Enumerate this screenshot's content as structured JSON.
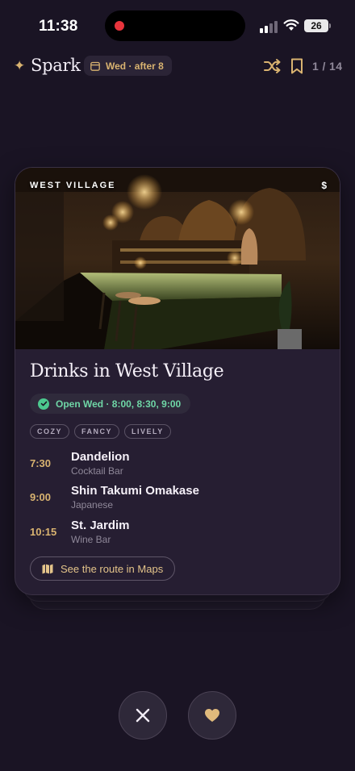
{
  "status_bar": {
    "time": "11:38",
    "battery": "26"
  },
  "header": {
    "app_name": "Spark",
    "date_filter": "Wed · after 8",
    "counter": "1 / 14"
  },
  "card": {
    "neighborhood": "WEST VILLAGE",
    "price": "$",
    "title": "Drinks in West Village",
    "availability": "Open Wed · 8:00, 8:30, 9:00",
    "tags": [
      "COZY",
      "FANCY",
      "LIVELY"
    ],
    "stops": [
      {
        "time": "7:30",
        "name": "Dandelion",
        "type": "Cocktail Bar"
      },
      {
        "time": "9:00",
        "name": "Shin Takumi Omakase",
        "type": "Japanese"
      },
      {
        "time": "10:15",
        "name": "St. Jardim",
        "type": "Wine Bar"
      }
    ],
    "route_button": "See the route in Maps"
  },
  "actions": {
    "pass_icon": "close-icon",
    "like_icon": "heart-icon"
  },
  "colors": {
    "background": "#1a1424",
    "card": "#261e32",
    "accent_gold": "#d9b370",
    "open_green": "#6fd6a6"
  }
}
